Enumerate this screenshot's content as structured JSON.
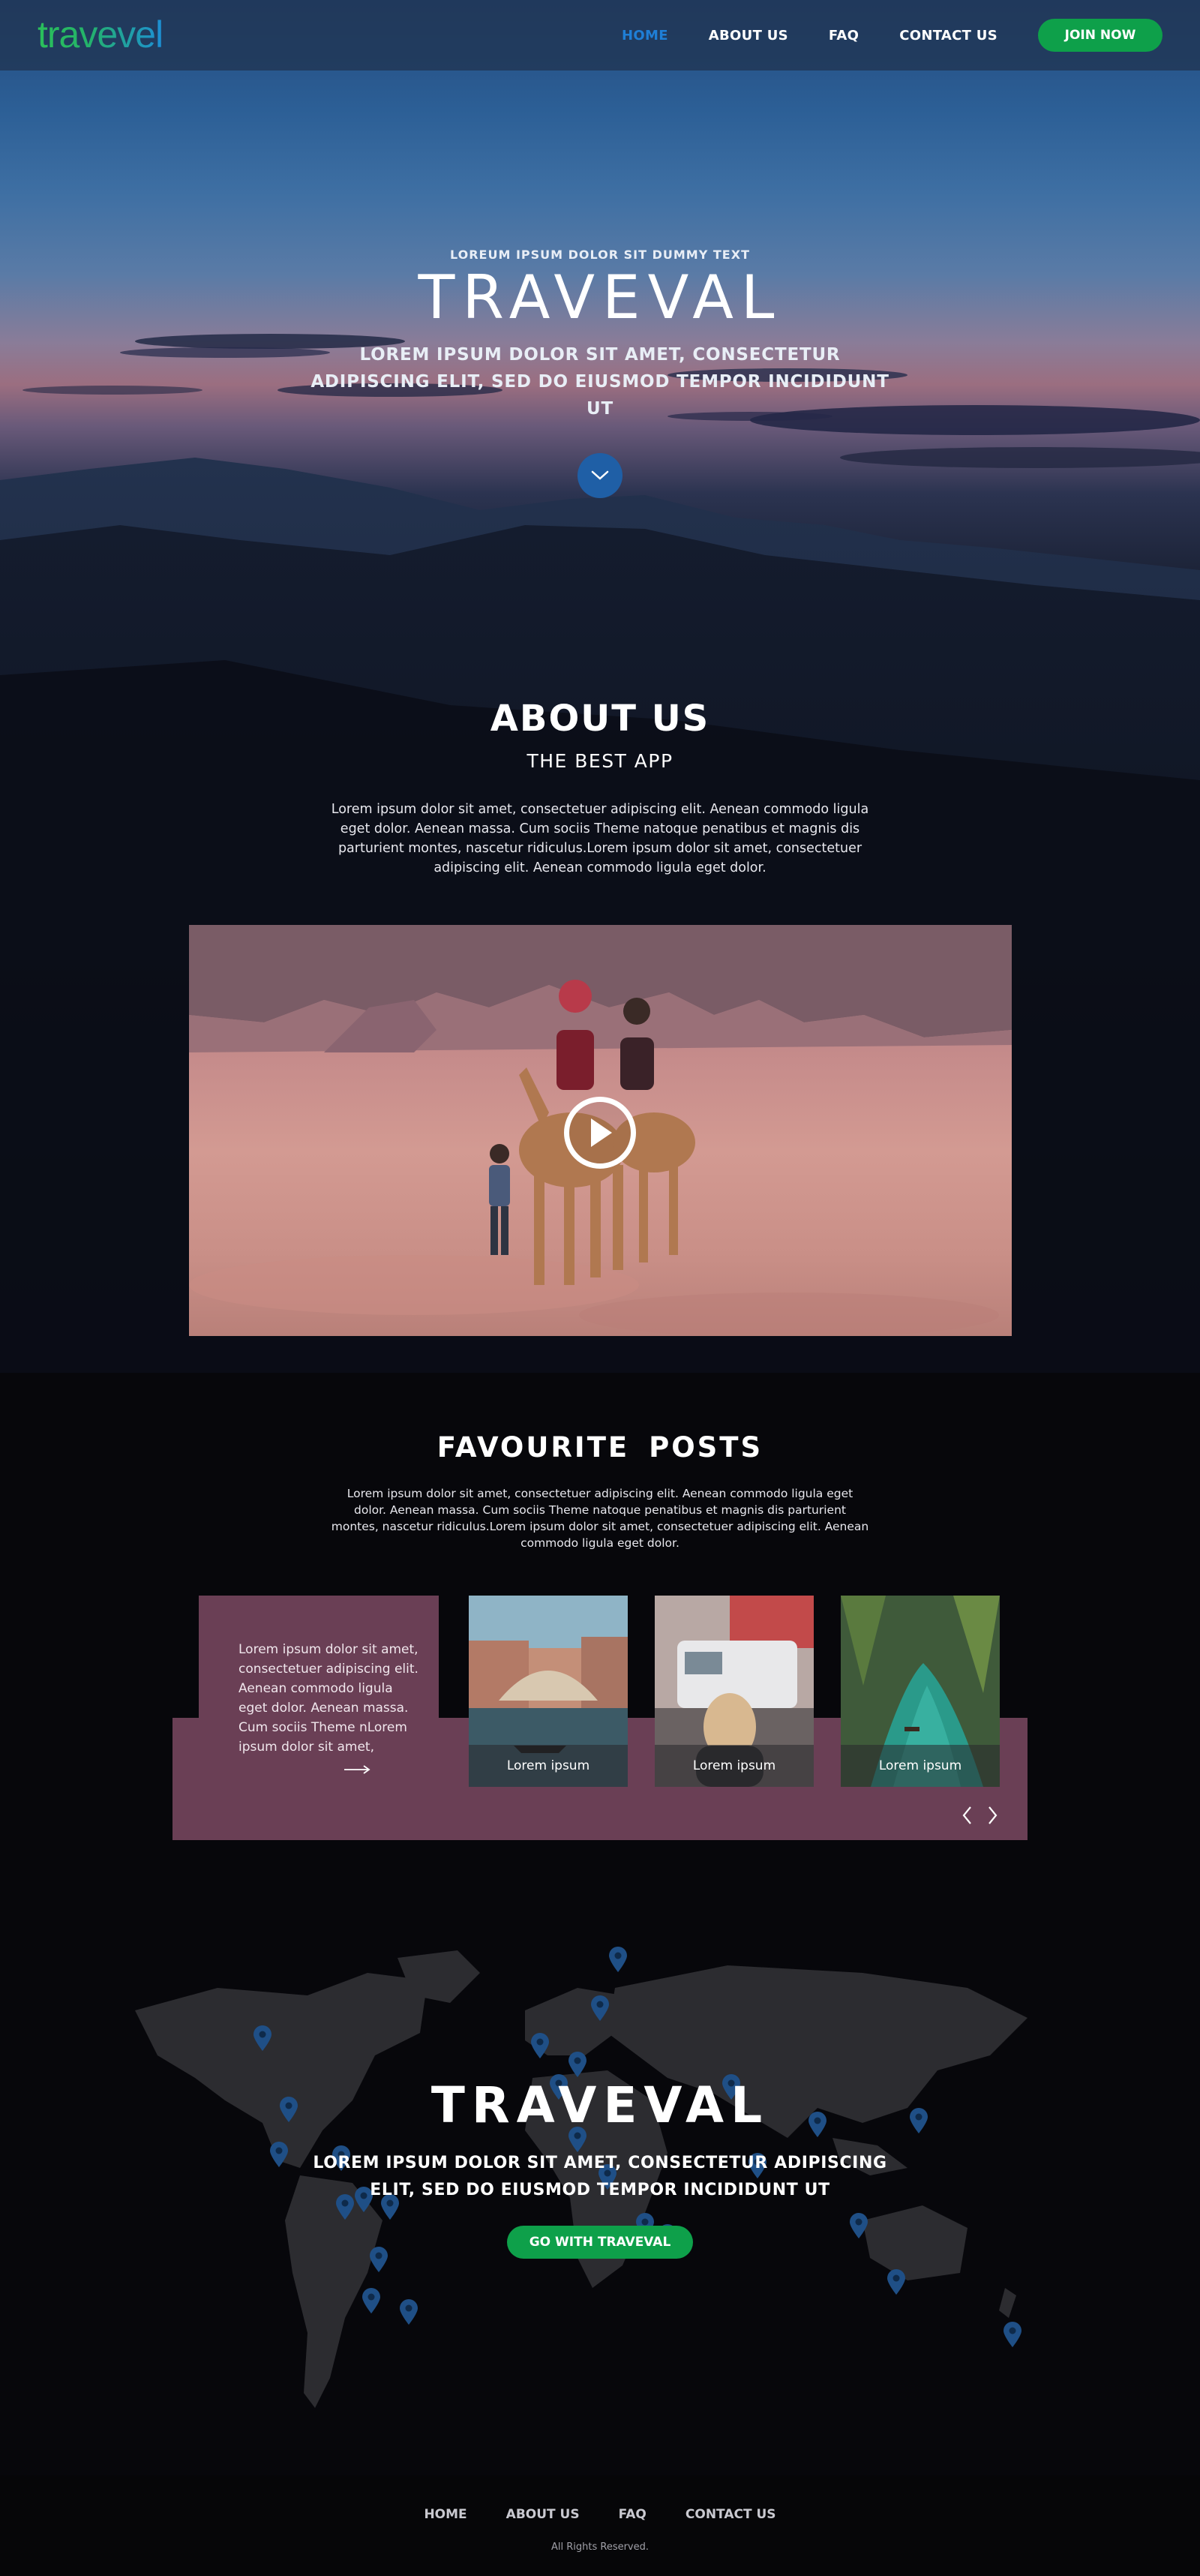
{
  "brand": {
    "logo": "travevel",
    "logo_colors": [
      "#2bbf5a",
      "#1d8fd6"
    ]
  },
  "nav": {
    "items": [
      {
        "label": "HOME",
        "active": true
      },
      {
        "label": "ABOUT US",
        "active": false
      },
      {
        "label": "FAQ",
        "active": false
      },
      {
        "label": "CONTACT US",
        "active": false
      }
    ],
    "cta": "JOIN NOW"
  },
  "hero": {
    "kicker": "LOREUM IPSUM DOLOR SIT DUMMY TEXT",
    "title": "TRAVEVAL",
    "subtitle": "LOREM IPSUM DOLOR SIT AMET, CONSECTETUR ADIPISCING ELIT, SED DO EIUSMOD TEMPOR INCIDIDUNT UT",
    "scroll_icon": "chevron-down-icon"
  },
  "about": {
    "title": "ABOUT US",
    "subtitle": "THE BEST APP",
    "text": "Lorem ipsum dolor sit amet, consectetuer adipiscing elit. Aenean commodo ligula eget dolor. Aenean massa. Cum sociis Theme natoque penatibus et magnis dis parturient montes, nascetur ridiculus.Lorem ipsum dolor sit amet, consectetuer adipiscing elit. Aenean commodo ligula eget dolor.",
    "video_icon": "play-icon"
  },
  "posts": {
    "title": "FAVOURITE  POSTS",
    "text": "Lorem ipsum dolor sit amet, consectetuer adipiscing elit. Aenean commodo ligula eget dolor. Aenean massa. Cum sociis Theme natoque penatibus et magnis dis parturient montes, nascetur ridiculus.Lorem ipsum dolor sit amet, consectetuer adipiscing elit. Aenean commodo ligula eget dolor.",
    "card_text": "Lorem ipsum dolor sit amet, consectetuer adipiscing elit. Aenean commodo ligula eget dolor. Aenean massa. Cum sociis Theme nLorem ipsum dolor sit amet,",
    "items": [
      {
        "caption": "Lorem ipsum"
      },
      {
        "caption": "Lorem ipsum"
      },
      {
        "caption": "Lorem ipsum"
      }
    ],
    "accent": "#6a3f55"
  },
  "cta": {
    "title": "TRAVEVAL",
    "subtitle": "LOREM IPSUM DOLOR SIT AMET, CONSECTETUR ADIPISCING ELIT, SED DO EIUSMOD TEMPOR INCIDIDUNT UT",
    "button": "GO WITH TRAVEVAL"
  },
  "footer": {
    "links": [
      "HOME",
      "ABOUT US",
      "FAQ",
      "CONTACT US"
    ],
    "copyright": "All Rights Reserved."
  },
  "colors": {
    "primary_green": "#0ea04a",
    "accent_blue": "#1f7fd6",
    "background": "#07070b"
  }
}
